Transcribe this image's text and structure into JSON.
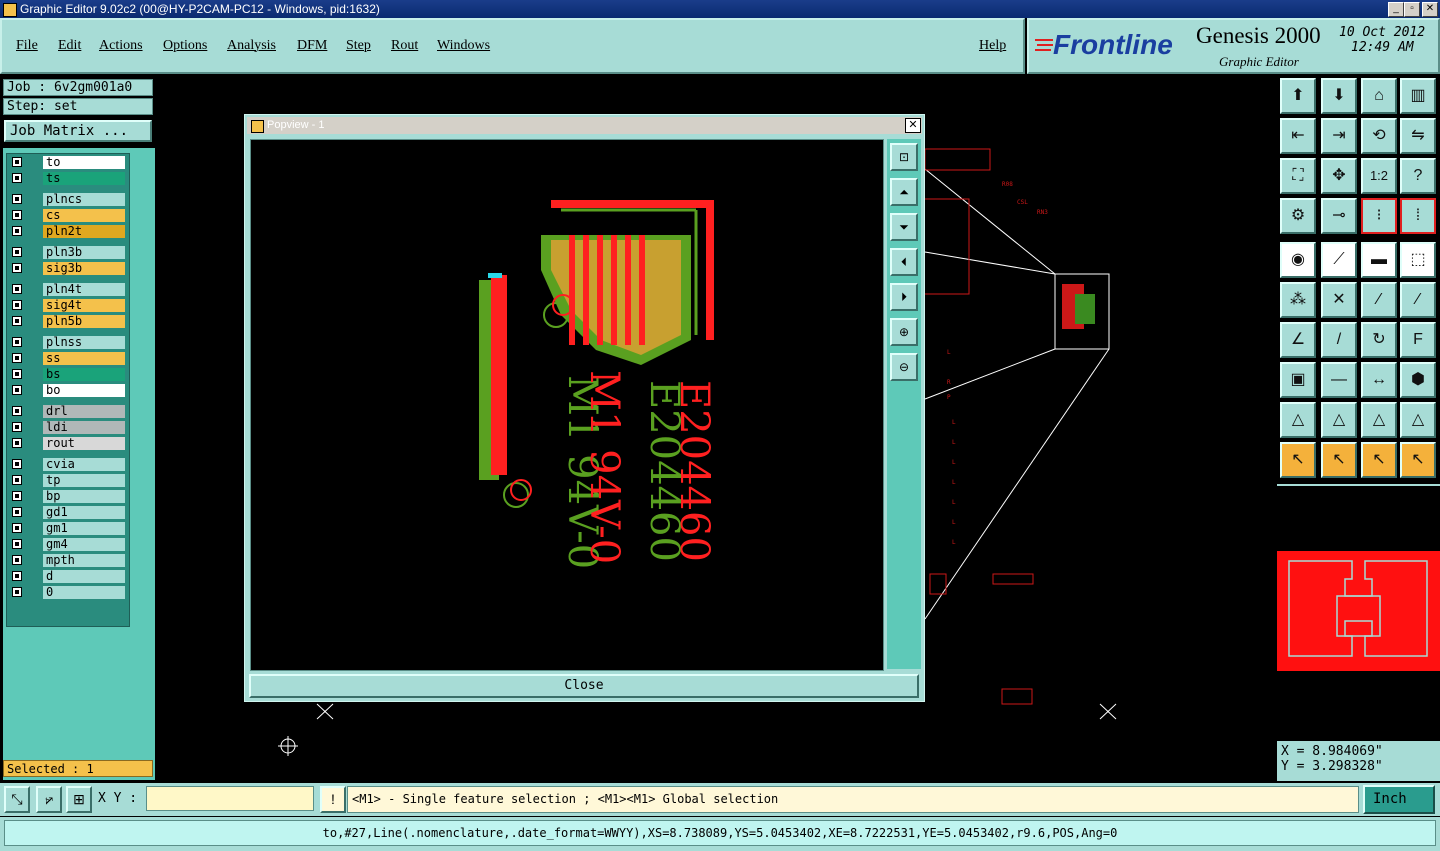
{
  "window": {
    "title": "Graphic Editor 9.02c2 (00@HY-P2CAM-PC12 - Windows, pid:1632)"
  },
  "menu": {
    "items": [
      "File",
      "Edit",
      "Actions",
      "Options",
      "Analysis",
      "DFM",
      "Step",
      "Rout",
      "Windows"
    ],
    "help": "Help"
  },
  "brand": {
    "logo": "Frontline",
    "product": "Genesis 2000",
    "subtitle": "Graphic Editor",
    "date": "10 Oct 2012",
    "time": "12:49 AM"
  },
  "job": {
    "label": "Job : 6v2gm001a0",
    "step": "Step: set",
    "matrix_button": "Job Matrix ..."
  },
  "layers": [
    {
      "name": "to",
      "color": "#ffffff"
    },
    {
      "name": "ts",
      "color": "#1aa37a"
    },
    {
      "name": "plncs",
      "color": "#a7dcd6"
    },
    {
      "name": "cs",
      "color": "#f4c14b"
    },
    {
      "name": "pln2t",
      "color": "#e0a820"
    },
    {
      "name": "pln3b",
      "color": "#a7dcd6"
    },
    {
      "name": "sig3b",
      "color": "#f4c14b"
    },
    {
      "name": "pln4t",
      "color": "#a7dcd6"
    },
    {
      "name": "sig4t",
      "color": "#f4c14b"
    },
    {
      "name": "pln5b",
      "color": "#f4c14b"
    },
    {
      "name": "plnss",
      "color": "#a7dcd6"
    },
    {
      "name": "ss",
      "color": "#f4c14b"
    },
    {
      "name": "bs",
      "color": "#1aa37a"
    },
    {
      "name": "bo",
      "color": "#ffffff"
    },
    {
      "name": "drl",
      "color": "#b0b8b8"
    },
    {
      "name": "ldi",
      "color": "#b0b8b8"
    },
    {
      "name": "rout",
      "color": "#d8d8d8"
    },
    {
      "name": "cvia",
      "color": "#a7dcd6"
    },
    {
      "name": "tp",
      "color": "#a7dcd6"
    },
    {
      "name": "bp",
      "color": "#a7dcd6"
    },
    {
      "name": "gd1",
      "color": "#a7dcd6"
    },
    {
      "name": "gm1",
      "color": "#a7dcd6"
    },
    {
      "name": "gm4",
      "color": "#a7dcd6"
    },
    {
      "name": "mpth",
      "color": "#a7dcd6"
    },
    {
      "name": "d",
      "color": "#a7dcd6"
    },
    {
      "name": "0",
      "color": "#a7dcd6"
    }
  ],
  "selected": "Selected : 1",
  "popview": {
    "title": "Popview - 1",
    "close": "Close",
    "text1": "E204460",
    "text2": "M1 94V-0"
  },
  "coords": {
    "x": "X = 8.984069\"",
    "y": "Y = 3.298328\""
  },
  "input": {
    "xy_label": "X Y :",
    "hint": "<M1> - Single feature selection ; <M1><M1> Global selection",
    "units": "Inch"
  },
  "status": "to,#27,Line(.nomenclature,.date_format=WWYY),XS=8.738089,YS=5.0453402,XE=8.7222531,YE=5.0453402,r9.6,POS,Ang=0",
  "colors": {
    "panel": "#a7dcd6",
    "teal": "#5ec9b8",
    "canvas": "#000000",
    "red": "#ff2020",
    "green": "#5aa020",
    "orange": "#f4c14b"
  }
}
